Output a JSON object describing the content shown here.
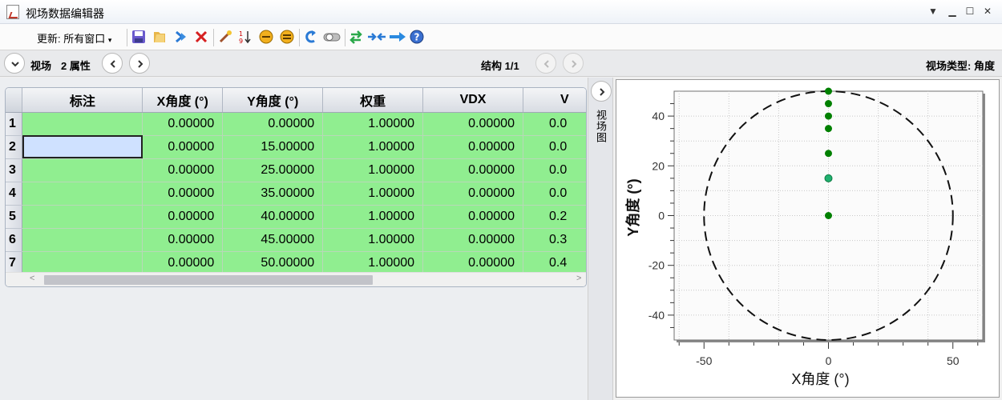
{
  "window": {
    "title": "视场数据编辑器"
  },
  "toolbar": {
    "update_label": "更新: 所有窗口"
  },
  "nav": {
    "field_label": "视场",
    "attr_count": "2 属性",
    "structure": "结构 1/1",
    "field_type": "视场类型: 角度"
  },
  "table": {
    "columns": [
      "标注",
      "X角度 (°)",
      "Y角度 (°)",
      "权重",
      "VDX",
      "V"
    ],
    "rows": [
      {
        "num": "1",
        "label": "",
        "x": "0.00000",
        "y": "0.00000",
        "w": "1.00000",
        "vdx": "0.00000",
        "v": "0.0"
      },
      {
        "num": "2",
        "label": "",
        "x": "0.00000",
        "y": "15.00000",
        "w": "1.00000",
        "vdx": "0.00000",
        "v": "0.0"
      },
      {
        "num": "3",
        "label": "",
        "x": "0.00000",
        "y": "25.00000",
        "w": "1.00000",
        "vdx": "0.00000",
        "v": "0.0"
      },
      {
        "num": "4",
        "label": "",
        "x": "0.00000",
        "y": "35.00000",
        "w": "1.00000",
        "vdx": "0.00000",
        "v": "0.0"
      },
      {
        "num": "5",
        "label": "",
        "x": "0.00000",
        "y": "40.00000",
        "w": "1.00000",
        "vdx": "0.00000",
        "v": "0.2"
      },
      {
        "num": "6",
        "label": "",
        "x": "0.00000",
        "y": "45.00000",
        "w": "1.00000",
        "vdx": "0.00000",
        "v": "0.3"
      },
      {
        "num": "7",
        "label": "",
        "x": "0.00000",
        "y": "50.00000",
        "w": "1.00000",
        "vdx": "0.00000",
        "v": "0.4"
      }
    ],
    "row_color": "#90ee90",
    "selected_color": "#cfe1ff"
  },
  "side_tab": {
    "label": "视场图"
  },
  "chart_data": {
    "type": "scatter",
    "xlabel": "X角度 (°)",
    "ylabel": "Y角度 (°)",
    "xlim": [
      -62,
      62
    ],
    "ylim": [
      -50,
      50
    ],
    "xticks": [
      -50,
      0,
      50
    ],
    "yticks": [
      -40,
      -20,
      0,
      20,
      40
    ],
    "grid": true,
    "points": [
      {
        "x": 0,
        "y": 0
      },
      {
        "x": 0,
        "y": 15,
        "highlight": true
      },
      {
        "x": 0,
        "y": 25
      },
      {
        "x": 0,
        "y": 35
      },
      {
        "x": 0,
        "y": 40
      },
      {
        "x": 0,
        "y": 45
      },
      {
        "x": 0,
        "y": 50
      }
    ],
    "boundary_circle_radius": 50,
    "point_color": "#008000",
    "highlight_color": "#20b070"
  }
}
